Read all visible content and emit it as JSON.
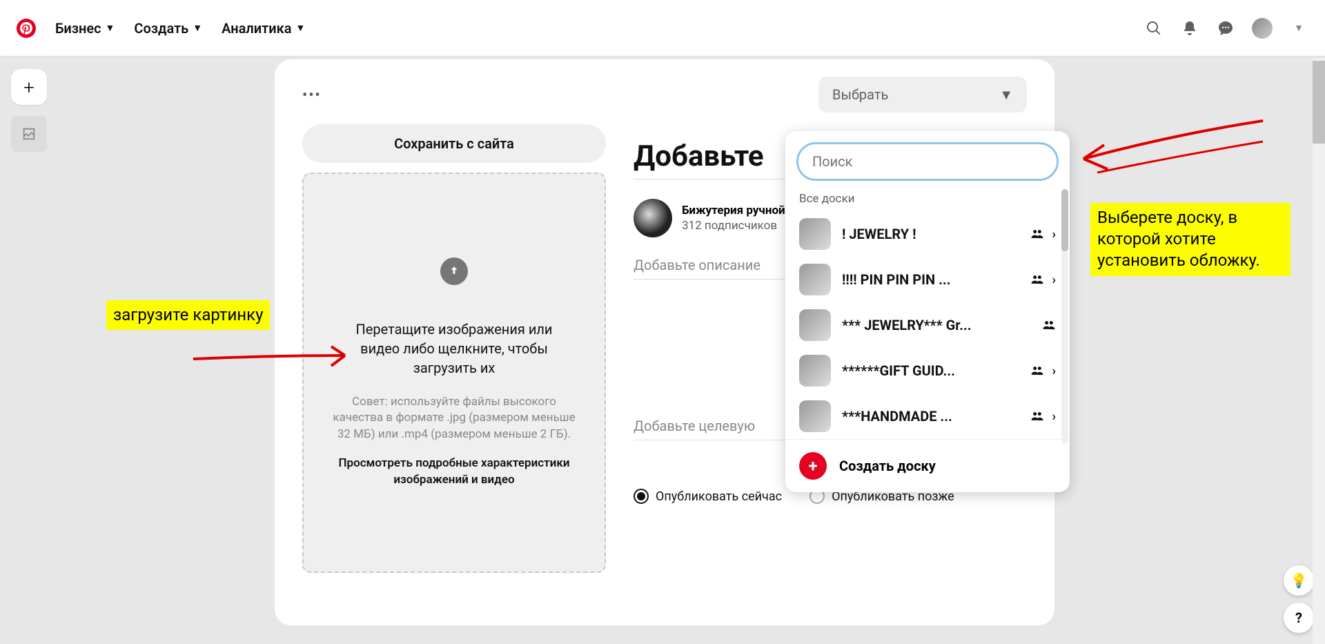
{
  "header": {
    "nav": {
      "business": "Бизнес",
      "create": "Создать",
      "analytics": "Аналитика"
    }
  },
  "leftRail": {
    "add": "+"
  },
  "card": {
    "selectBoard": "Выбрать",
    "saveFromSite": "Сохранить с сайта",
    "upload": {
      "main": "Перетащите изображения или видео либо щелкните, чтобы загрузить их",
      "hint": "Совет: используйте файлы высокого качества в формате .jpg (размером меньше 32 МБ) или .mp4 (размером меньше 2 ГБ).",
      "link": "Просмотреть подробные характеристики изображений и видео"
    },
    "titlePlaceholder": "Добавьте",
    "profile": {
      "name": "Бижутерия ручной работы | Сережки | Брошь для книг",
      "followers": "312 подписчиков"
    },
    "descPlaceholder": "Добавьте описание",
    "targetPlaceholder": "Добавьте целевую",
    "publishNow": "Опубликовать сейчас",
    "publishLater": "Опубликовать позже"
  },
  "dropdown": {
    "searchPlaceholder": "Поиск",
    "sectionLabel": "Все доски",
    "items": [
      {
        "name": "! JEWELRY !",
        "group": true,
        "arrow": true
      },
      {
        "name": "!!!! PIN PIN PIN ...",
        "group": true,
        "arrow": true
      },
      {
        "name": "*** JEWELRY*** Gr...",
        "group": true,
        "arrow": false
      },
      {
        "name": "******GIFT GUID...",
        "group": true,
        "arrow": true
      },
      {
        "name": "***HANDMADE ...",
        "group": true,
        "arrow": true
      }
    ],
    "createLabel": "Создать доску"
  },
  "annotations": {
    "left": "загрузите картинку",
    "right": "Выберете доску, в которой хотите установить обложку."
  }
}
